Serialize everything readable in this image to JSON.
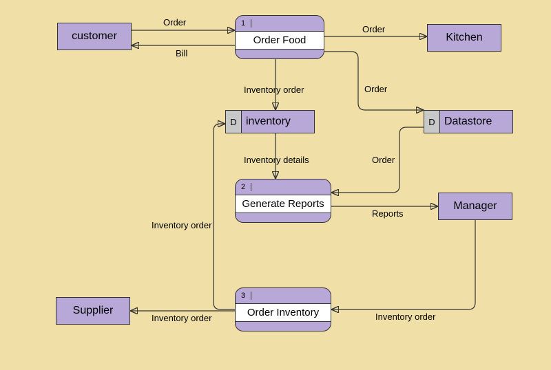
{
  "entities": {
    "customer": {
      "label": "customer"
    },
    "kitchen": {
      "label": "Kitchen"
    },
    "manager": {
      "label": "Manager"
    },
    "supplier": {
      "label": "Supplier"
    }
  },
  "processes": {
    "order_food": {
      "num": "1",
      "label": "Order Food"
    },
    "generate_reports": {
      "num": "2",
      "label": "Generate Reports"
    },
    "order_inventory": {
      "num": "3",
      "label": "Order Inventory"
    }
  },
  "datastores": {
    "inventory": {
      "tag": "D",
      "label": "inventory"
    },
    "datastore": {
      "tag": "D",
      "label": "Datastore"
    }
  },
  "flows": {
    "f1": "Order",
    "f2": "Bill",
    "f3": "Order",
    "f4": "Inventory order",
    "f5": "Order",
    "f6": "Inventory details",
    "f7": "Order",
    "f8": "Reports",
    "f9": "Inventory order",
    "f10": "Inventory order",
    "f11": "Inventory order"
  }
}
